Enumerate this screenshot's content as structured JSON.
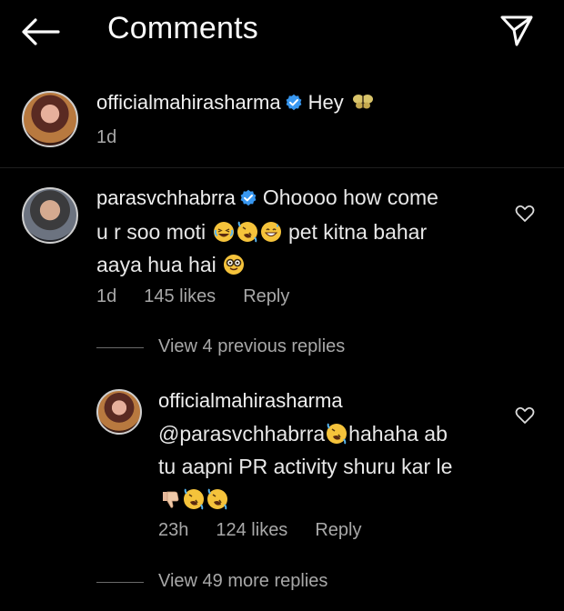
{
  "header": {
    "title": "Comments",
    "back_icon": "arrow-left-icon",
    "send_icon": "paper-plane-icon"
  },
  "caption": {
    "username": "officialmahirasharma",
    "text": "Hey",
    "emoji": "butterfly",
    "time": "1d"
  },
  "comment": {
    "username": "parasvchhabrra",
    "line1": "Ohoooo how come",
    "line2_pre": "u r soo moti",
    "line2_post": "pet kitna bahar",
    "line3": "aaya hua hai",
    "time": "1d",
    "likes": "145 likes",
    "reply_label": "Reply"
  },
  "view_previous": "View 4 previous replies",
  "reply": {
    "username": "officialmahirasharma",
    "line1_mention": "@parasvchhabrra",
    "line1_post": "hahaha ab",
    "line2": "tu aapni PR activity shuru kar le",
    "time": "23h",
    "likes": "124 likes",
    "reply_label": "Reply"
  },
  "view_more": "View 49 more replies",
  "colors": {
    "background": "#000000",
    "verified": "#3897f0",
    "secondary_text": "#a8a8a8"
  }
}
